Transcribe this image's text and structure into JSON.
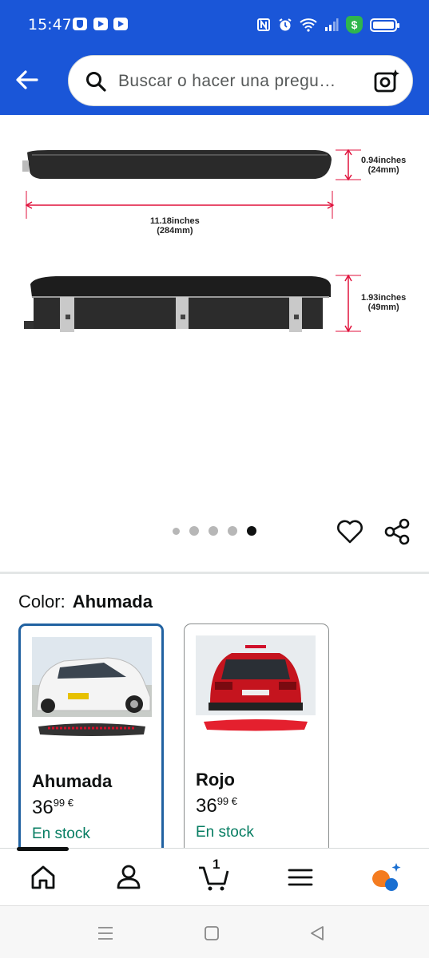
{
  "status_bar": {
    "time": "15:47",
    "icons": [
      "shield-app-icon",
      "youtube-icon",
      "youtube-icon",
      "nfc-icon",
      "alarm-icon",
      "wifi-icon",
      "signal-icon",
      "dollar-badge-icon",
      "battery-icon"
    ],
    "badge_symbol": "$"
  },
  "header": {
    "search_placeholder": "Buscar o hacer una pregu…",
    "accent_color": "#1a56d8"
  },
  "product_image": {
    "dimensions": {
      "height_top": "0.94inches",
      "height_top_mm": "(24mm)",
      "length": "11.18inches",
      "length_mm": "(284mm)",
      "height_full": "1.93inches",
      "height_full_mm": "(49mm)"
    },
    "carousel": {
      "total": 5,
      "active_index": 4
    }
  },
  "variations": {
    "label": "Color:",
    "selected": "Ahumada",
    "options": [
      {
        "name": "Ahumada",
        "price_whole": "36",
        "price_fraction": "99",
        "currency": "€",
        "stock": "En stock",
        "selected": true
      },
      {
        "name": "Rojo",
        "price_whole": "36",
        "price_fraction": "99",
        "currency": "€",
        "stock": "En stock",
        "selected": false
      }
    ]
  },
  "bottom_nav": {
    "items": [
      "home-icon",
      "account-icon",
      "cart-icon",
      "menu-icon",
      "rufus-ai-icon"
    ],
    "cart_count": "1"
  },
  "system_nav": {
    "items": [
      "recent-apps-icon",
      "home-button-icon",
      "back-triangle-icon"
    ]
  }
}
